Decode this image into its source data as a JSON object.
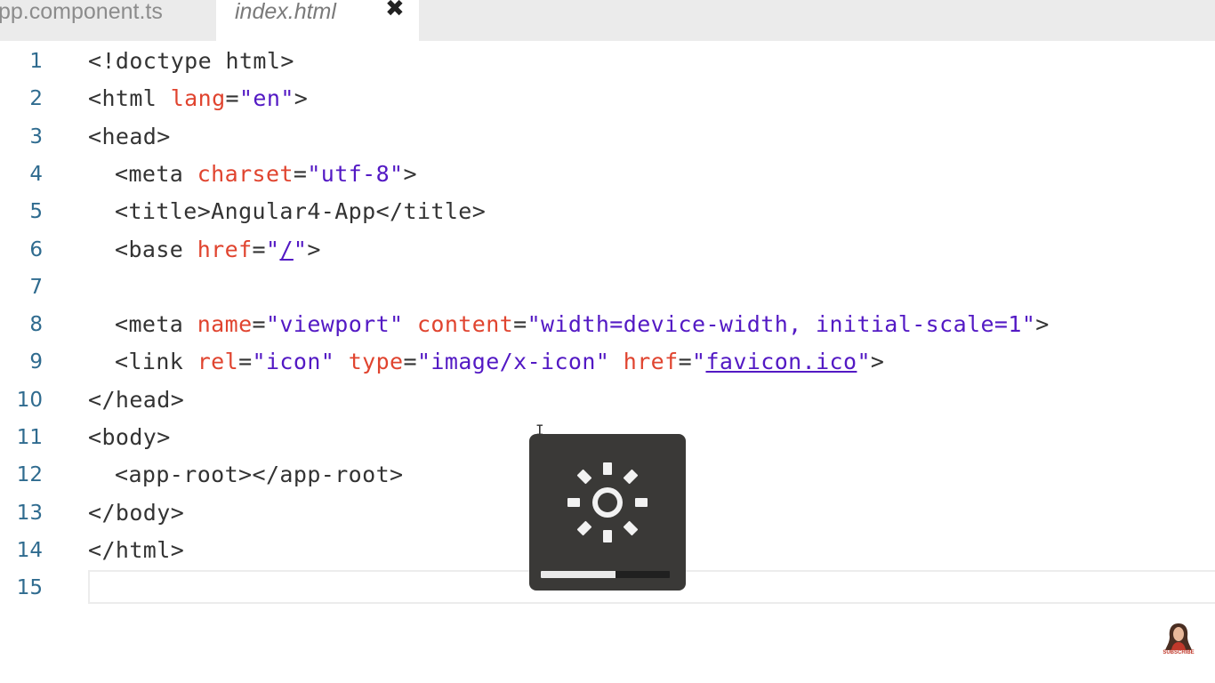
{
  "tabs": [
    {
      "label": "pp.component.ts",
      "active": false
    },
    {
      "label": "index.html",
      "active": true,
      "close_glyph": "✖"
    }
  ],
  "editor": {
    "lines": [
      {
        "num": "1",
        "tokens": [
          {
            "t": "tag",
            "v": "<!doctype html>"
          }
        ]
      },
      {
        "num": "2",
        "tokens": [
          {
            "t": "tag",
            "v": "<html "
          },
          {
            "t": "attr",
            "v": "lang"
          },
          {
            "t": "eq",
            "v": "="
          },
          {
            "t": "str",
            "v": "\"en\""
          },
          {
            "t": "tag",
            "v": ">"
          }
        ]
      },
      {
        "num": "3",
        "tokens": [
          {
            "t": "tag",
            "v": "<head>"
          }
        ]
      },
      {
        "num": "4",
        "indent": true,
        "tokens": [
          {
            "t": "tag",
            "v": "<meta "
          },
          {
            "t": "attr",
            "v": "charset"
          },
          {
            "t": "eq",
            "v": "="
          },
          {
            "t": "str",
            "v": "\"utf-8\""
          },
          {
            "t": "tag",
            "v": ">"
          }
        ]
      },
      {
        "num": "5",
        "indent": true,
        "tokens": [
          {
            "t": "tag",
            "v": "<title>"
          },
          {
            "t": "txt",
            "v": "Angular4-App"
          },
          {
            "t": "tag",
            "v": "</title>"
          }
        ]
      },
      {
        "num": "6",
        "indent": true,
        "tokens": [
          {
            "t": "tag",
            "v": "<base "
          },
          {
            "t": "attr",
            "v": "href"
          },
          {
            "t": "eq",
            "v": "="
          },
          {
            "t": "str",
            "v": "\""
          },
          {
            "t": "link",
            "v": "/"
          },
          {
            "t": "str",
            "v": "\""
          },
          {
            "t": "tag",
            "v": ">"
          }
        ]
      },
      {
        "num": "7",
        "tokens": []
      },
      {
        "num": "8",
        "indent": true,
        "tokens": [
          {
            "t": "tag",
            "v": "<meta "
          },
          {
            "t": "attr",
            "v": "name"
          },
          {
            "t": "eq",
            "v": "="
          },
          {
            "t": "str",
            "v": "\"viewport\""
          },
          {
            "t": "tag",
            "v": " "
          },
          {
            "t": "attr",
            "v": "content"
          },
          {
            "t": "eq",
            "v": "="
          },
          {
            "t": "str",
            "v": "\"width=device-width, initial-scale=1\""
          },
          {
            "t": "tag",
            "v": ">"
          }
        ]
      },
      {
        "num": "9",
        "indent": true,
        "tokens": [
          {
            "t": "tag",
            "v": "<link "
          },
          {
            "t": "attr",
            "v": "rel"
          },
          {
            "t": "eq",
            "v": "="
          },
          {
            "t": "str",
            "v": "\"icon\""
          },
          {
            "t": "tag",
            "v": " "
          },
          {
            "t": "attr",
            "v": "type"
          },
          {
            "t": "eq",
            "v": "="
          },
          {
            "t": "str",
            "v": "\"image/x-icon\""
          },
          {
            "t": "tag",
            "v": " "
          },
          {
            "t": "attr",
            "v": "href"
          },
          {
            "t": "eq",
            "v": "="
          },
          {
            "t": "str",
            "v": "\""
          },
          {
            "t": "link",
            "v": "favicon.ico"
          },
          {
            "t": "str",
            "v": "\""
          },
          {
            "t": "tag",
            "v": ">"
          }
        ]
      },
      {
        "num": "10",
        "tokens": [
          {
            "t": "tag",
            "v": "</head>"
          }
        ]
      },
      {
        "num": "11",
        "tokens": [
          {
            "t": "tag",
            "v": "<body>"
          }
        ]
      },
      {
        "num": "12",
        "indent": true,
        "tokens": [
          {
            "t": "tag",
            "v": "<app-root></app-root>"
          }
        ]
      },
      {
        "num": "13",
        "tokens": [
          {
            "t": "tag",
            "v": "</body>"
          }
        ]
      },
      {
        "num": "14",
        "tokens": [
          {
            "t": "tag",
            "v": "</html>"
          }
        ]
      },
      {
        "num": "15",
        "tokens": [],
        "current": true
      }
    ]
  },
  "brightness_osd": {
    "icon": "sun-icon",
    "level": 0.58
  },
  "channel_badge": {
    "text": "SUBSCRIBE",
    "icon": "avatar-icon"
  },
  "colors": {
    "tag": "#333333",
    "attr": "#e0442f",
    "string": "#5319c4",
    "line_number": "#2f6b8f",
    "osd_bg": "#3a3937"
  }
}
